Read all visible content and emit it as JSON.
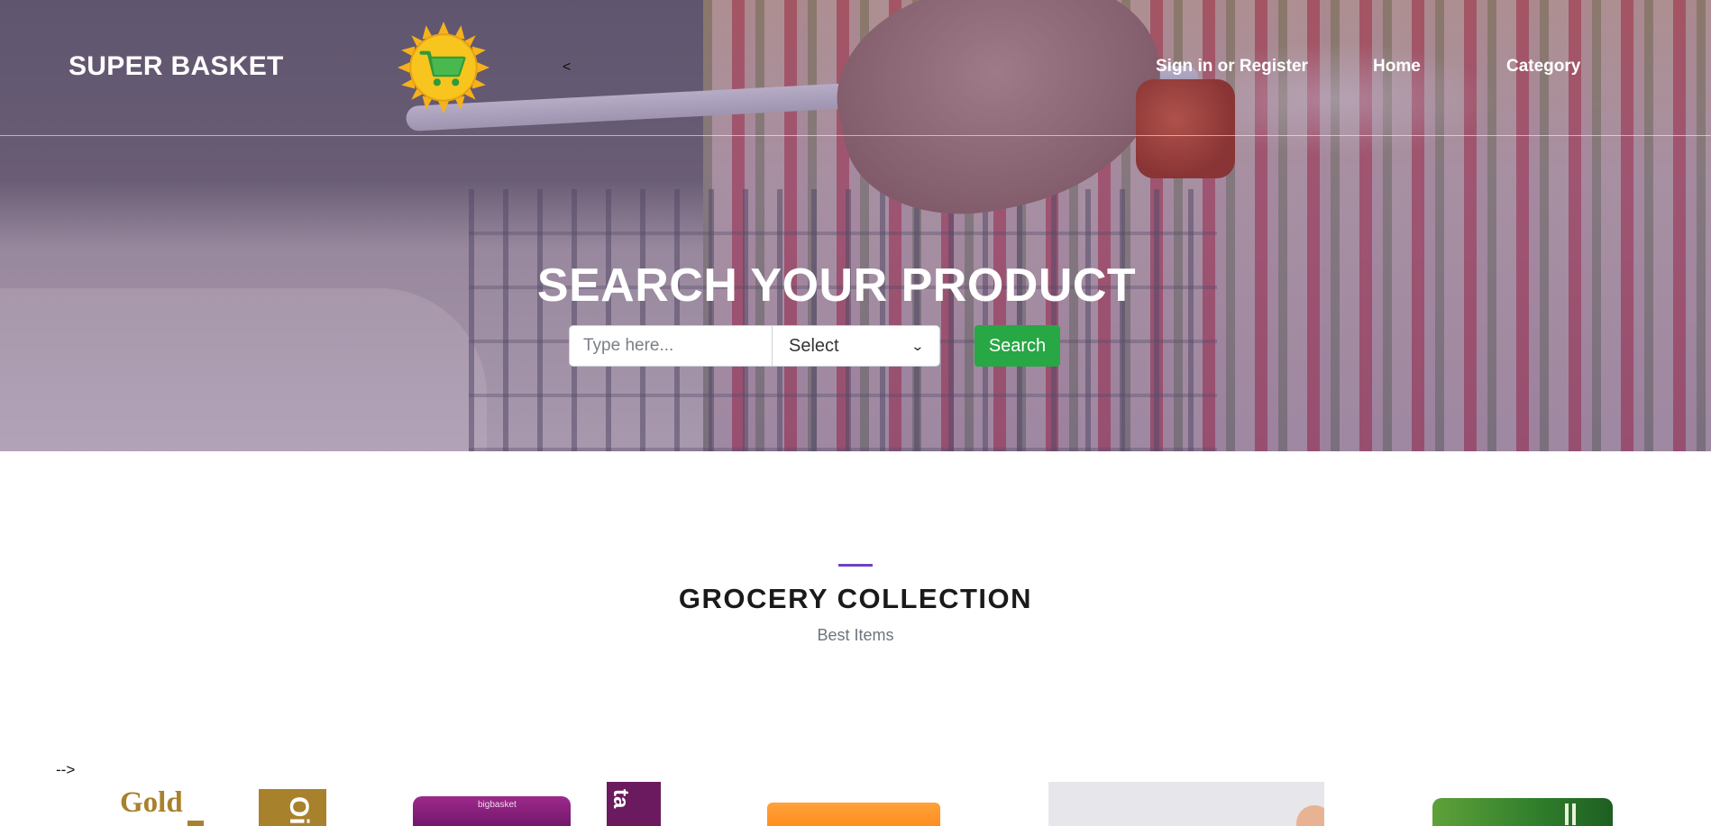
{
  "brand": {
    "name": "SUPER BASKET",
    "logo_icon": "sun-cart-logo-icon"
  },
  "nav": {
    "stray_char": "<",
    "links": [
      {
        "label": "Sign in or Register"
      },
      {
        "label": "Home"
      },
      {
        "label": "Category"
      }
    ]
  },
  "hero": {
    "title": "SEARCH YOUR PRODUCT",
    "search": {
      "placeholder": "Type here...",
      "select_value": "Select",
      "button_label": "Search"
    }
  },
  "section": {
    "title": "GROCERY COLLECTION",
    "subtitle": "Best Items",
    "stray_text": "-->"
  },
  "products": [
    {
      "visible_text": "Gold",
      "side_text": "Oil"
    },
    {
      "visible_text": "bigbasket",
      "side_text": "ta"
    },
    {
      "visible_text": ""
    },
    {
      "visible_text": ""
    },
    {
      "visible_text": ""
    }
  ],
  "colors": {
    "accent_purple": "#6f42c1",
    "search_green": "#28a745",
    "hero_overlay": "#4a2c70",
    "gold": "#a8812c"
  }
}
